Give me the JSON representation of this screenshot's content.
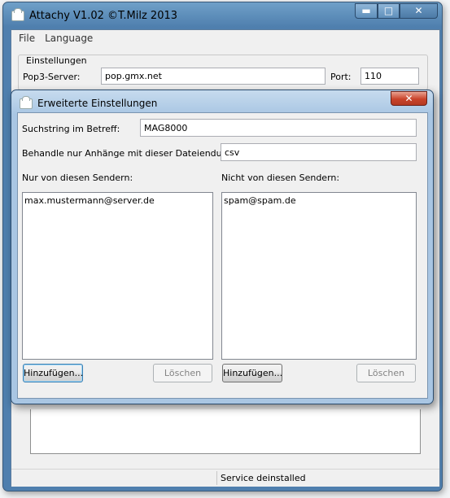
{
  "main_window": {
    "title": "Attachy V1.02 ©T.Milz 2013",
    "caption_buttons": {
      "minimize": "▬",
      "maximize": "□",
      "close": "✕"
    },
    "menu": [
      "File",
      "Language"
    ],
    "settings": {
      "legend": "Einstellungen",
      "pop3_label": "Pop3-Server:",
      "pop3_value": "pop.gmx.net",
      "port_label": "Port:",
      "port_value": "110"
    },
    "status": "Service deinstalled"
  },
  "dialog": {
    "title": "Erweiterte Einstellungen",
    "close_glyph": "✕",
    "subject_label": "Suchstring im Betreff:",
    "subject_value": "MAG8000",
    "extension_label": "Behandle nur Anhänge mit dieser Dateiendung:",
    "extension_value": "csv",
    "allow_label": "Nur von diesen Sendern:",
    "allow_items": [
      "max.mustermann@server.de"
    ],
    "deny_label": "Nicht von diesen Sendern:",
    "deny_items": [
      "spam@spam.de"
    ],
    "add_label": "Hinzufügen...",
    "delete_label": "Löschen"
  },
  "colors": {
    "titlebar": "#4f7fae",
    "dialog_titlebar": "#a9c6e3",
    "close_red": "#c9432a"
  }
}
